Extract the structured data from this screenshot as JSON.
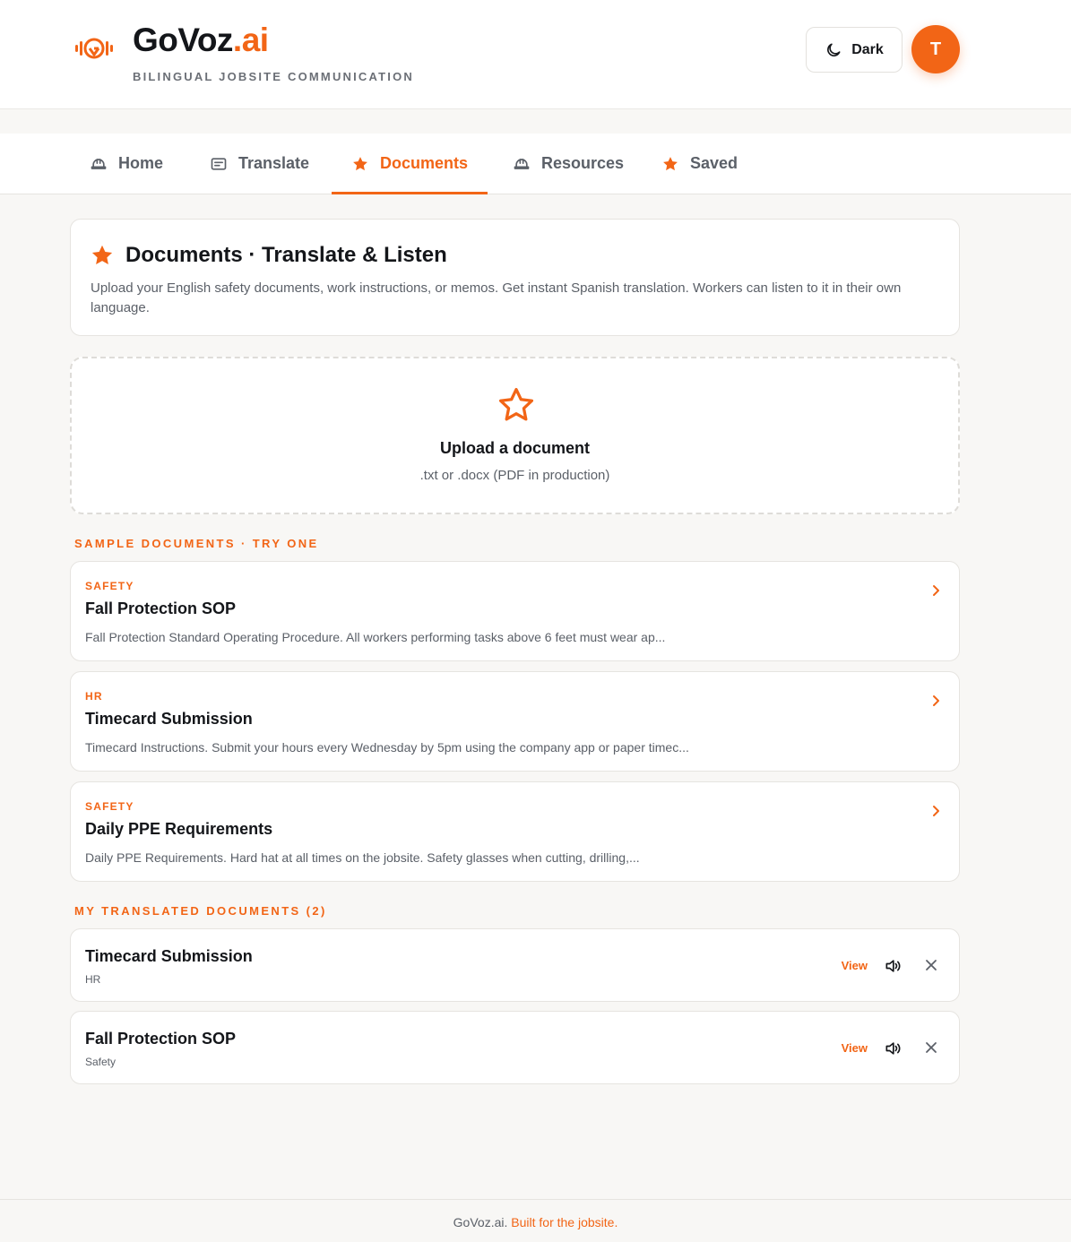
{
  "header": {
    "brand_main": "GoVoz",
    "brand_suffix": ".ai",
    "tagline": "BILINGUAL JOBSITE COMMUNICATION",
    "theme_toggle_label": "Dark",
    "avatar_initial": "T"
  },
  "nav": {
    "tabs": [
      {
        "label": "Home",
        "icon": "hardhat-icon"
      },
      {
        "label": "Translate",
        "icon": "document-icon"
      },
      {
        "label": "Documents",
        "icon": "star-icon",
        "active": true
      },
      {
        "label": "Resources",
        "icon": "hardhat-icon"
      },
      {
        "label": "Saved",
        "icon": "star-icon"
      }
    ]
  },
  "intro": {
    "title": "Documents · Translate & Listen",
    "description": "Upload your English safety documents, work instructions, or memos. Get instant Spanish translation. Workers can listen to it in their own language."
  },
  "upload": {
    "title": "Upload a document",
    "subtitle": ".txt or .docx (PDF in production)"
  },
  "samples": {
    "label": "SAMPLE DOCUMENTS · TRY ONE",
    "items": [
      {
        "category": "SAFETY",
        "title": "Fall Protection SOP",
        "excerpt": "Fall Protection Standard Operating Procedure. All workers performing tasks above 6 feet must wear ap..."
      },
      {
        "category": "HR",
        "title": "Timecard Submission",
        "excerpt": "Timecard Instructions. Submit your hours every Wednesday by 5pm using the company app or paper timec..."
      },
      {
        "category": "SAFETY",
        "title": "Daily PPE Requirements",
        "excerpt": "Daily PPE Requirements. Hard hat at all times on the jobsite. Safety glasses when cutting, drilling,..."
      }
    ]
  },
  "my_docs": {
    "label": "MY TRANSLATED DOCUMENTS (2)",
    "view_label": "View",
    "items": [
      {
        "title": "Timecard Submission",
        "category": "HR"
      },
      {
        "title": "Fall Protection SOP",
        "category": "Safety"
      }
    ]
  },
  "footer": {
    "brand": "GoVoz.ai.",
    "tagline": "Built for the jobsite."
  },
  "colors": {
    "accent": "#f26516",
    "text": "#14161a",
    "muted": "#5b6068",
    "background": "#f8f7f5"
  }
}
